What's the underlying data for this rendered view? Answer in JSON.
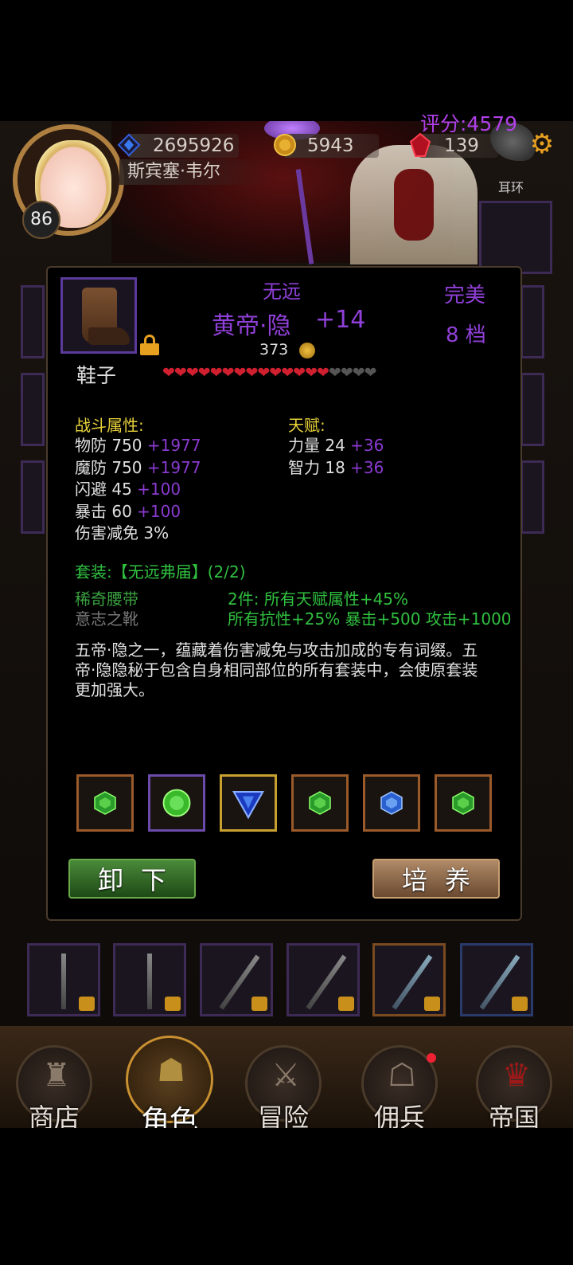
{
  "header": {
    "level": "86",
    "player_name": "斯宾塞·韦尔",
    "power": "2695926",
    "gold": "5943",
    "gems": "139",
    "score": "评分:4579",
    "earring_label": "耳环"
  },
  "item": {
    "rarity_top": "无远",
    "name": "黄帝·隐",
    "enhance": "+14",
    "quality": "完美",
    "grade": "8 档",
    "price": "373",
    "type": "鞋子",
    "hearts_filled": 14,
    "hearts_total": 18,
    "combat_title": "战斗属性:",
    "talent_title": "天赋:",
    "combat_stats": [
      {
        "label": "物防 750",
        "bonus": "+1977"
      },
      {
        "label": "魔防 750",
        "bonus": "+1977"
      },
      {
        "label": "闪避 45",
        "bonus": "+100"
      },
      {
        "label": "暴击 60",
        "bonus": "+100"
      },
      {
        "label": "伤害减免 3%",
        "bonus": ""
      }
    ],
    "talent_stats": [
      {
        "label": "力量 24",
        "bonus": "+36"
      },
      {
        "label": "智力 18",
        "bonus": "+36"
      }
    ],
    "set_title": "套装:【无远弗届】(2/2)",
    "set_items": [
      "稀奇腰带",
      "意志之靴"
    ],
    "set_bonus_1": "2件: 所有天赋属性+45%",
    "set_bonus_2": "所有抗性+25% 暴击+500 攻击+1000",
    "description": "五帝·隐之一，蕴藏着伤害减免与攻击加成的专有词缀。五帝·隐隐秘于包含自身相同部位的所有套装中，会使原套装更加强大。",
    "gems": [
      {
        "kind": "emerald-hex",
        "frame": "orange"
      },
      {
        "kind": "emerald-round",
        "frame": "purple"
      },
      {
        "kind": "sapphire-triangle",
        "frame": "gold"
      },
      {
        "kind": "emerald-hex",
        "frame": "orange"
      },
      {
        "kind": "sapphire-hex",
        "frame": "orange"
      },
      {
        "kind": "emerald-hex",
        "frame": "orange"
      }
    ],
    "unequip_label": "卸下",
    "cultivate_label": "培养"
  },
  "nav": [
    {
      "label": "商店",
      "icon": "castle-icon"
    },
    {
      "label": "角色",
      "icon": "hood-icon",
      "active": true
    },
    {
      "label": "冒险",
      "icon": "crossed-swords-icon"
    },
    {
      "label": "佣兵",
      "icon": "mercenary-card-icon"
    },
    {
      "label": "帝国",
      "icon": "crown-icon"
    }
  ],
  "colors": {
    "accent_purple": "#9040d8",
    "stat_yellow": "#e8d23a",
    "set_green": "#30c040",
    "heart_red": "#d02030"
  }
}
